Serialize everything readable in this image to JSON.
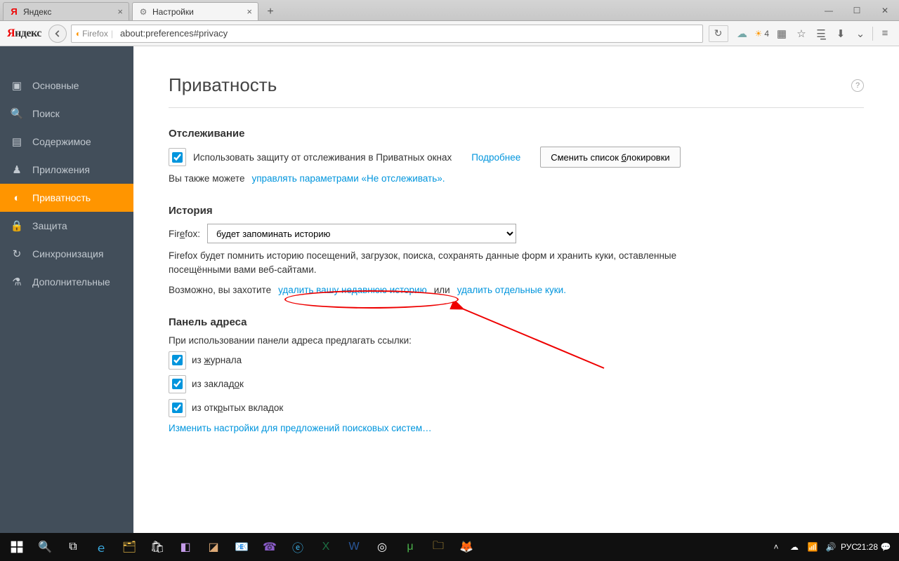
{
  "tabs": [
    {
      "label": "Яндекс",
      "active": false
    },
    {
      "label": "Настройки",
      "active": true
    }
  ],
  "url": "about:preferences#privacy",
  "identity_label": "Firefox",
  "weather_temp": "4",
  "sidebar": {
    "items": [
      {
        "label": "Основные",
        "icon": "◻"
      },
      {
        "label": "Поиск",
        "icon": "🔍"
      },
      {
        "label": "Содержимое",
        "icon": "≣"
      },
      {
        "label": "Приложения",
        "icon": "♟"
      },
      {
        "label": "Приватность",
        "icon": "◑",
        "active": true
      },
      {
        "label": "Защита",
        "icon": "🔒"
      },
      {
        "label": "Синхронизация",
        "icon": "↻"
      },
      {
        "label": "Дополнительные",
        "icon": "⚗"
      }
    ]
  },
  "page": {
    "title": "Приватность",
    "tracking": {
      "heading": "Отслеживание",
      "checkbox_label": "Использовать защиту от отслеживания в Приватных окнах",
      "learn_more": "Подробнее",
      "change_blocklist": "Сменить список блокировки",
      "also_text": "Вы также можете ",
      "dnt_link": "управлять параметрами «Не отслеживать»"
    },
    "history": {
      "heading": "История",
      "firefox_label": "Firefox:",
      "mode_value": "будет запоминать историю",
      "desc": "Firefox будет помнить историю посещений, загрузок, поиска, сохранять данные форм и хранить куки, оставленные посещёнными вами веб-сайтами.",
      "maybe_prefix": "Возможно, вы захотите ",
      "clear_recent": "удалить вашу недавнюю историю",
      "or_text": " или ",
      "remove_cookies": "удалить отдельные куки"
    },
    "locationbar": {
      "heading": "Панель адреса",
      "suggest_label": "При использовании панели адреса предлагать ссылки:",
      "opt_history": "из журнала",
      "opt_bookmarks": "из закладок",
      "opt_opentabs": "из открытых вкладок",
      "change_search": "Изменить настройки для предложений поисковых систем…"
    }
  },
  "tray": {
    "lang": "РУС",
    "time": "21:28"
  }
}
